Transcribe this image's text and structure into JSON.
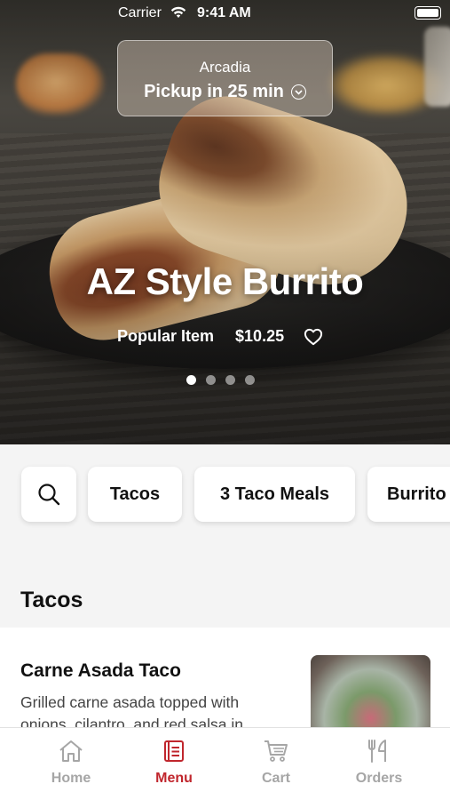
{
  "status_bar": {
    "carrier": "Carrier",
    "time": "9:41 AM"
  },
  "location": {
    "name": "Arcadia",
    "pickup": "Pickup in 25 min"
  },
  "hero": {
    "title": "AZ Style Burrito",
    "tag": "Popular Item",
    "price": "$10.25",
    "carousel_count": 4,
    "carousel_active_index": 0
  },
  "categories": {
    "items": [
      "Tacos",
      "3 Taco Meals",
      "Burrito"
    ]
  },
  "section": {
    "title": "Tacos"
  },
  "menu_item": {
    "name": "Carne Asada Taco",
    "description": "Grilled carne asada topped with onions, cilantro, and red salsa in..."
  },
  "tabbar": {
    "items": [
      {
        "label": "Home",
        "icon": "home-icon"
      },
      {
        "label": "Menu",
        "icon": "menu-icon"
      },
      {
        "label": "Cart",
        "icon": "cart-icon"
      },
      {
        "label": "Orders",
        "icon": "orders-icon"
      }
    ],
    "active": "Menu",
    "active_color": "#c0262d",
    "inactive_color": "#a6a6a6"
  }
}
